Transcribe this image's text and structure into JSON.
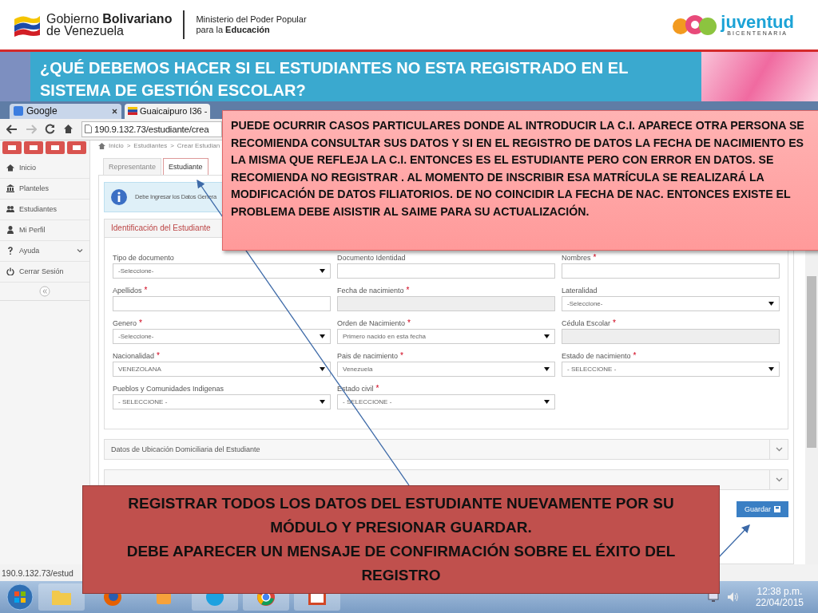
{
  "header": {
    "gov_line1": "Gobierno **Bolivariano**",
    "gov_line2": "de Venezuela",
    "ministry_line1": "Ministerio  del Poder Popular",
    "ministry_line2": "para la **Educación**",
    "logo_word": "juventud",
    "logo_sub": "BICENTENARIA"
  },
  "slide_title": "¿QUÉ DEBEMOS HACER SI EL ESTUDIANTES NO ESTA REGISTRADO EN EL SISTEMA DE GESTIÓN ESCOLAR?",
  "browser": {
    "tabs": [
      {
        "label": "Google",
        "selected": false
      },
      {
        "label": "Guaicaipuro I36 -",
        "selected": true
      }
    ],
    "address": "190.9.132.73/estudiante/crea",
    "status": "190.9.132.73/estud"
  },
  "sidebar": {
    "items": [
      {
        "label": "Inicio",
        "kind": "home"
      },
      {
        "label": "Planteles",
        "kind": "bank"
      },
      {
        "label": "Estudiantes",
        "kind": "users"
      },
      {
        "label": "Mi Perfil",
        "kind": "user"
      },
      {
        "label": "Ayuda",
        "kind": "help",
        "expanded": false
      },
      {
        "label": "Cerrar Sesión",
        "kind": "power"
      }
    ]
  },
  "breadcrumb": [
    "Inicio",
    ">",
    "Estudiantes",
    ">",
    "Crear Estudian"
  ],
  "form_tabs": [
    {
      "label": "Representante",
      "selected": false
    },
    {
      "label": "Estudiante",
      "selected": true
    }
  ],
  "info_message": "Debe Ingresar los Datos Genera",
  "panel_title": "Identificación del Estudiante",
  "fields": [
    {
      "label": "Tipo de documento",
      "kind": "select",
      "value": "-Seleccione-"
    },
    {
      "label": "Documento Identidad",
      "kind": "text"
    },
    {
      "label": "Nombres",
      "required_mark": "*",
      "kind": "text"
    },
    {
      "label": "Apellidos",
      "required_mark": "*",
      "kind": "text"
    },
    {
      "label": "Fecha de nacimiento",
      "required_mark": "*",
      "kind": "readonly"
    },
    {
      "label": "Lateralidad",
      "kind": "select",
      "value": "-Seleccione-"
    },
    {
      "label": "Genero",
      "required_mark": "*",
      "kind": "select",
      "value": "-Seleccione-"
    },
    {
      "label": "Orden de Nacimiento",
      "required_mark": "*",
      "kind": "select",
      "value": "Primero nacido en esta fecha"
    },
    {
      "label": "Cédula Escolar",
      "required_mark": "*",
      "kind": "readonly"
    },
    {
      "label": "Nacionalidad",
      "required_mark": "*",
      "kind": "select",
      "value": "VENEZOLANA"
    },
    {
      "label": "Pais de nacimiento",
      "required_mark": "*",
      "kind": "select",
      "value": "Venezuela"
    },
    {
      "label": "Estado de nacimiento",
      "required_mark": "*",
      "kind": "select",
      "value": "- SELECCIONE -"
    },
    {
      "label": "Pueblos y Comunidades Indigenas",
      "kind": "select",
      "value": "- SELECCIONE -"
    },
    {
      "label": "Estado civil",
      "required_mark": "*",
      "kind": "select",
      "value": "- SELECCIONE -"
    }
  ],
  "accordion_title": "Datos de Ubicación Domiciliaria del Estudiante",
  "save_button": "Guardar",
  "callout_top": "PUEDE OCURRIR CASOS PARTICULARES DONDE AL INTRODUCIR LA C.I. APARECE OTRA PERSONA SE RECOMIENDA CONSULTAR SUS DATOS  Y SI EN EL REGISTRO DE DATOS LA FECHA DE NACIMIENTO ES LA MISMA QUE REFLEJA LA C.I. ENTONCES ES EL ESTUDIANTE PERO CON ERROR EN DATOS. SE RECOMIENDA NO REGISTRAR . AL MOMENTO DE INSCRIBIR ESA MATRÍCULA SE REALIZARÁ LA MODIFICACIÓN DE DATOS FILIATORIOS. DE NO COINCIDIR LA FECHA DE NAC. ENTONCES EXISTE EL PROBLEMA DEBE AISISTIR AL SAIME PARA SU ACTUALIZACIÓN.",
  "callout_bottom": [
    "REGISTRAR TODOS LOS DATOS DEL ESTUDIANTE NUEVAMENTE POR SU MÓDULO Y PRESIONAR GUARDAR.",
    "DEBE APARECER UN MENSAJE DE CONFIRMACIÓN SOBRE EL ÉXITO DEL REGISTRO"
  ],
  "taskbar": {
    "time": "12:38 p.m.",
    "date": "22/04/2015"
  }
}
